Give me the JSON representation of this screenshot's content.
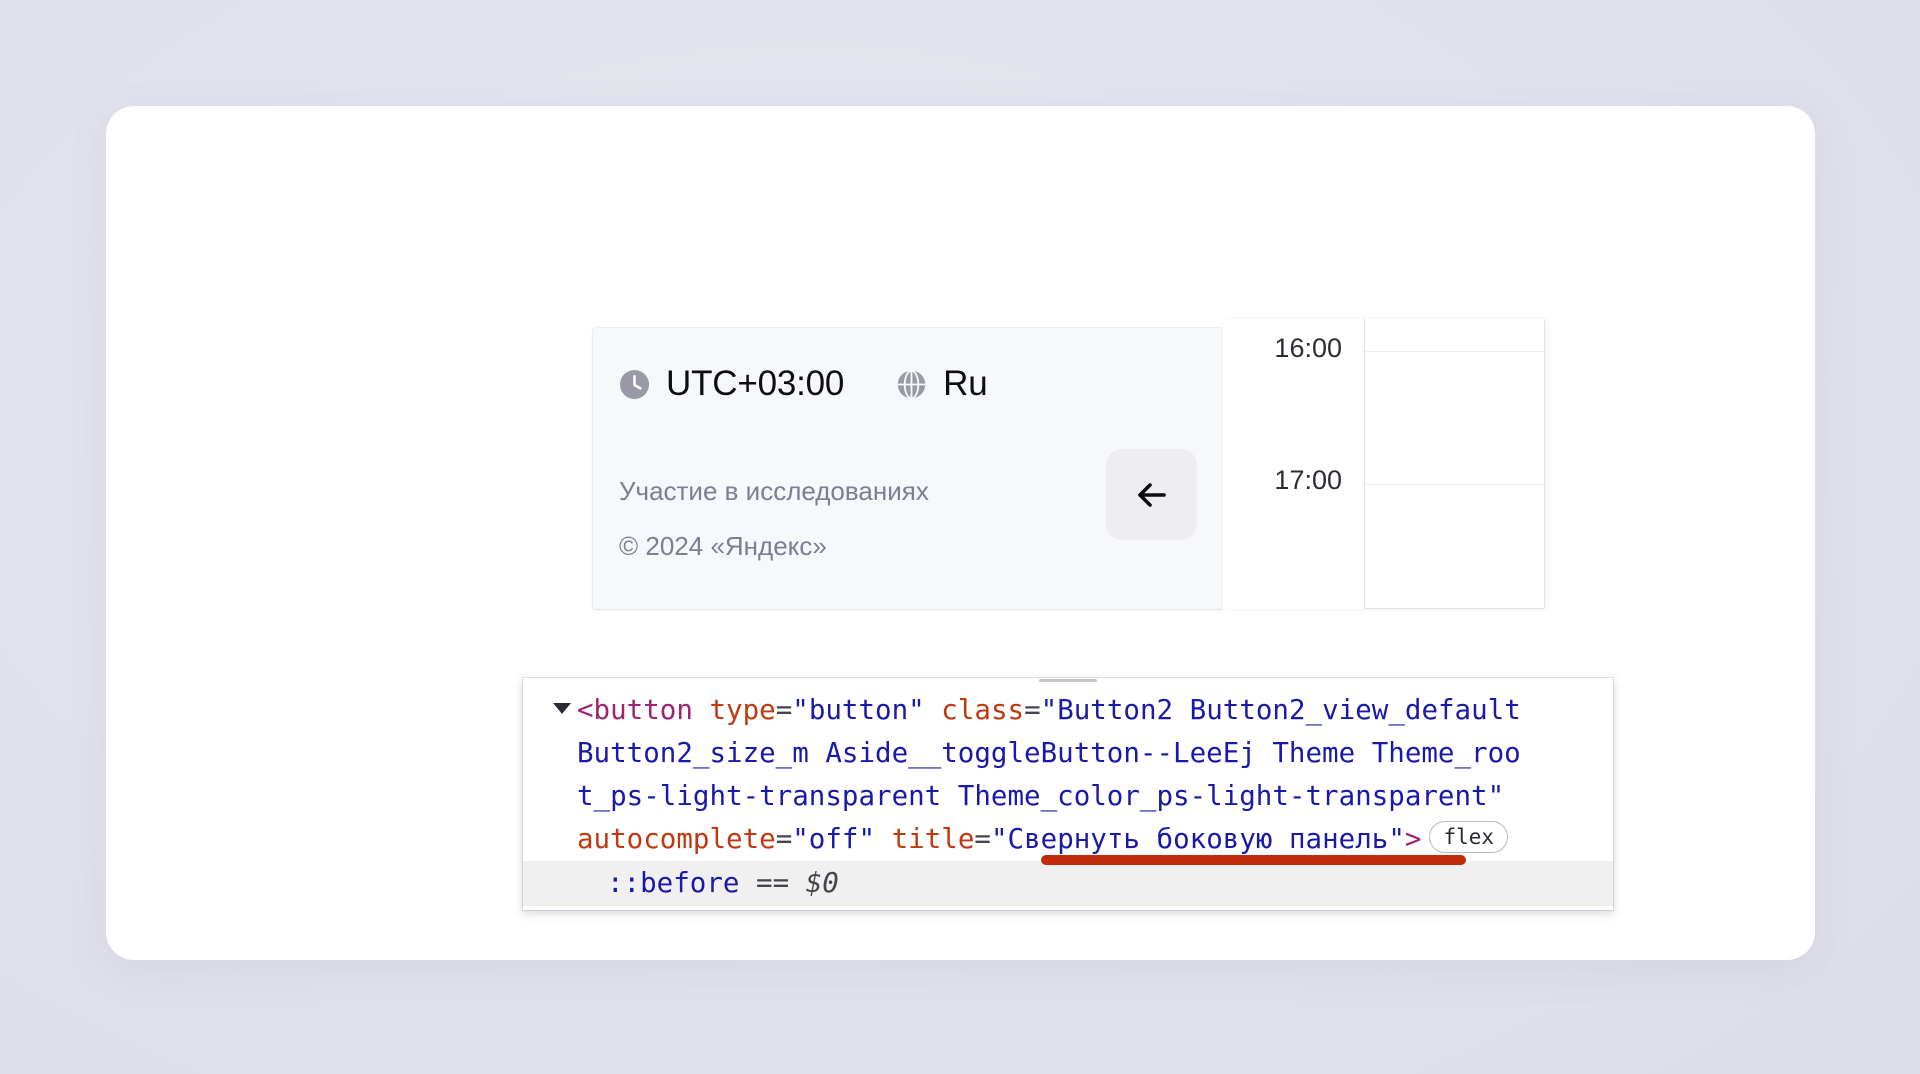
{
  "page": {
    "background_color": "#e3e3ed",
    "card_background": "#ffffff"
  },
  "sidebar_footer": {
    "panel_background": "#f7f8fb",
    "locale": [
      {
        "icon": "clock-icon",
        "label": "UTC+03:00"
      },
      {
        "icon": "globe-icon",
        "label": "Ru"
      }
    ],
    "legal": [
      "Участие в исследованиях",
      "© 2024 «Яндекс»"
    ],
    "collapse_button": {
      "icon": "arrow-left-icon",
      "title": "Свернуть боковую панель",
      "background": "#eeeef0"
    }
  },
  "time_grid": {
    "labels": [
      "16:00",
      "17:00"
    ],
    "line_color": "#ececed",
    "border_color": "#e3e3e6"
  },
  "devtools": {
    "badge": "flex",
    "highlight_color": "#c12d0b",
    "selected_row_background": "#f0f0f0",
    "code": {
      "tag_open": "<button",
      "attr_type": "type",
      "val_type": "\"button\"",
      "attr_class": "class",
      "val_class_line1": "\"Button2 Button2_view_default",
      "val_class_line2": "Button2_size_m Aside__toggleButton--LeeEj Theme Theme_roo",
      "val_class_line3": "t_ps-light-transparent Theme_color_ps-light-transparent\"",
      "attr_autocomplete": "autocomplete",
      "val_autocomplete": "\"off\"",
      "attr_title": "title",
      "val_title": "\"Свернуть боковую панель\"",
      "tag_close": ">",
      "selected_line_pseudo": "::before",
      "selected_line_eq": "==",
      "selected_line_ref": "$0"
    },
    "colors": {
      "tag": "#a0246e",
      "attribute": "#c2390f",
      "value": "#1a1aa8"
    }
  }
}
